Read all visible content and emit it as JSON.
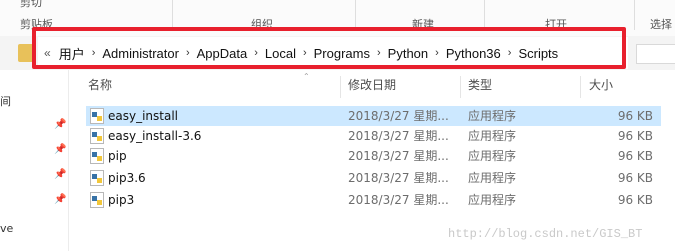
{
  "ribbon": {
    "items": [
      "剪贴板",
      "组织",
      "新建",
      "打开",
      "选择"
    ],
    "top_fragment": "剪切"
  },
  "address": {
    "lead": "«",
    "crumbs": [
      "用户",
      "Administrator",
      "AppData",
      "Local",
      "Programs",
      "Python",
      "Python36",
      "Scripts"
    ]
  },
  "nav": {
    "labels": [
      "",
      "间",
      "ve"
    ]
  },
  "columns": {
    "name": "名称",
    "date": "修改日期",
    "type": "类型",
    "size": "大小"
  },
  "files": [
    {
      "name": "easy_install",
      "date": "2018/3/27 星期...",
      "type": "应用程序",
      "size": "96 KB",
      "selected": true
    },
    {
      "name": "easy_install-3.6",
      "date": "2018/3/27 星期...",
      "type": "应用程序",
      "size": "96 KB",
      "selected": false
    },
    {
      "name": "pip",
      "date": "2018/3/27 星期...",
      "type": "应用程序",
      "size": "96 KB",
      "selected": false
    },
    {
      "name": "pip3.6",
      "date": "2018/3/27 星期...",
      "type": "应用程序",
      "size": "96 KB",
      "selected": false
    },
    {
      "name": "pip3",
      "date": "2018/3/27 星期...",
      "type": "应用程序",
      "size": "96 KB",
      "selected": false
    }
  ],
  "watermark": "http://blog.csdn.net/GIS_BT",
  "colors": {
    "selection": "#cce8ff",
    "highlight_box": "#e8202d",
    "folder": "#e8c15a"
  }
}
